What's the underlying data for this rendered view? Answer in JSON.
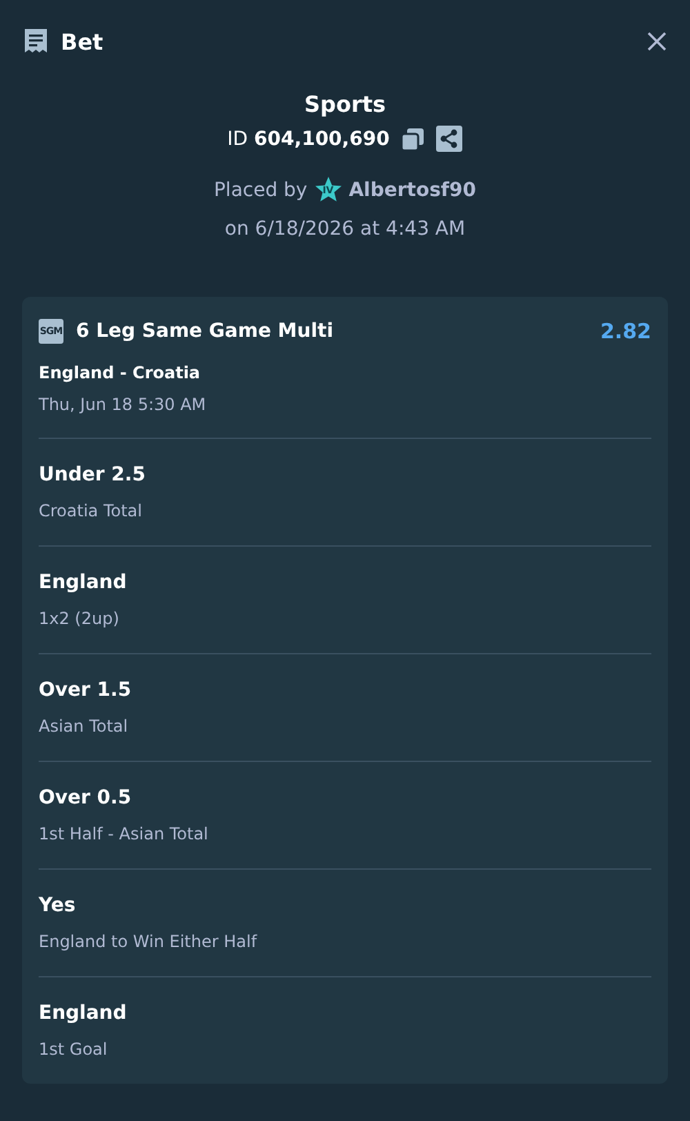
{
  "header": {
    "title": "Bet"
  },
  "bet": {
    "category": "Sports",
    "id_label": "ID",
    "id": "604,100,690",
    "placed_by_label": "Placed by",
    "vip_level": "IV",
    "user": "Albertosf90",
    "placed_on": "on 6/18/2026 at 4:43 AM"
  },
  "card": {
    "badge": "SGM",
    "title": "6 Leg Same Game Multi",
    "odds": "2.82",
    "match": "England - Croatia",
    "match_time": "Thu, Jun 18 5:30 AM",
    "legs": [
      {
        "selection": "Under 2.5",
        "market": "Croatia Total"
      },
      {
        "selection": "England",
        "market": "1x2 (2up)"
      },
      {
        "selection": "Over 1.5",
        "market": "Asian Total"
      },
      {
        "selection": "Over 0.5",
        "market": "1st Half - Asian Total"
      },
      {
        "selection": "Yes",
        "market": "England to Win Either Half"
      },
      {
        "selection": "England",
        "market": "1st Goal"
      }
    ]
  }
}
